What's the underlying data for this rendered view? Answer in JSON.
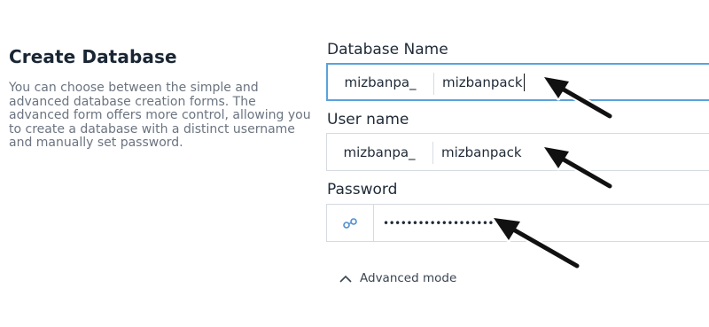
{
  "left": {
    "title": "Create Database",
    "description": "You can choose between the simple and advanced database creation forms. The advanced form offers more control, allowing you to create a database with a distinct username and manually set password."
  },
  "form": {
    "db_name_label": "Database Name",
    "db_prefix": "mizbanpa_",
    "db_value": "mizbanpack",
    "user_label": "User name",
    "user_prefix": "mizbanpa_",
    "user_value": "mizbanpack",
    "password_label": "Password",
    "password_value": "••••••••••••••••••••",
    "password_icon": "key-icon",
    "advanced_label": "Advanced mode",
    "advanced_icon": "chevron-up-icon"
  },
  "colors": {
    "focus_border": "#5aa2dc",
    "field_border": "#d6dbe1",
    "title": "#1a2634",
    "muted_text": "#6b7480"
  }
}
